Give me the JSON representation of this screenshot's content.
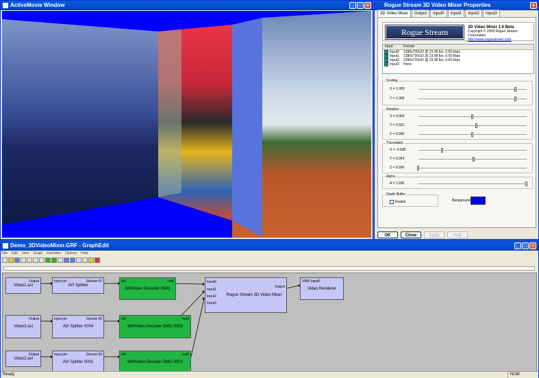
{
  "activemovie": {
    "title": "ActiveMovie Window",
    "min": "_",
    "max": "□",
    "close": "×"
  },
  "properties": {
    "title": "Rogue Stream 3D Video Mixer Properties",
    "tabs": [
      "3D Video Mixer",
      "Output",
      "Input0",
      "Input1",
      "Input2",
      "Input3"
    ],
    "banner": {
      "logo": "Rogue Stream",
      "product": "3D Video Mixer 1.0 Beta",
      "copyright": "Copyright © 2008 Rogue Stream Corporation",
      "url": "http://www.roguestream.com"
    },
    "input_list": {
      "headers": [
        "Input",
        "Format"
      ],
      "rows": [
        {
          "name": "Input0",
          "format": "1280x720x32 @ 23.98 fps, 0.00 kbps",
          "checked": true
        },
        {
          "name": "Input1",
          "format": "1280x720x32 @ 23.98 fps, 0.00 kbps",
          "checked": true
        },
        {
          "name": "Input2",
          "format": "1280x720x32 @ 23.98 fps, 0.00 kbps",
          "checked": true
        },
        {
          "name": "Input3",
          "format": "None",
          "checked": true
        }
      ]
    },
    "scaling": {
      "label": "Scaling",
      "x": "X = 1.000",
      "y": "Y = 1.000",
      "x_level": 0.9,
      "y_level": 0.9
    },
    "rotation": {
      "label": "Rotation",
      "x": "X = 0.000",
      "y": "Y = 0.591",
      "z": "Z = 0.000",
      "x_level": 0.5,
      "y_level": 0.54,
      "z_level": 0.5
    },
    "translation": {
      "label": "Translation",
      "x": "X = -0.538",
      "y": "Y = 0.043",
      "z": "Z = 0.000",
      "x_level": 0.22,
      "y_level": 0.51,
      "z_level": 0.0
    },
    "alpha": {
      "label": "Alpha",
      "a": "A = 1.000",
      "a_level": 1.0
    },
    "depth": {
      "label": "Depth Buffer",
      "enable": "Enable",
      "background": "Background",
      "bg_color": "#0000ff"
    },
    "buttons": {
      "ok": "OK",
      "close": "Close",
      "apply": "Apply",
      "help": "Help"
    }
  },
  "graphedit": {
    "title": "Demo_3DVideoMixer.GRF - GraphEdit",
    "menu": [
      "File",
      "Edit",
      "View",
      "Graph",
      "Favorites",
      "Options",
      "Help"
    ],
    "status": "Ready",
    "num": "NUM",
    "filters": {
      "video1": {
        "name": "Video1.avi",
        "out": "Output"
      },
      "video3": {
        "name": "Video3.avi",
        "out": "Output"
      },
      "video2": {
        "name": "Video2.avi",
        "out": "Output"
      },
      "split1": {
        "name": "AVI Splitter",
        "in": "input pin",
        "out": "Stream 00"
      },
      "split2": {
        "name": "AVI Splitter 0004",
        "in": "input pin",
        "out": "Stream 00"
      },
      "split3": {
        "name": "AVI Splitter 0001",
        "in": "input pin",
        "out": "Stream 00"
      },
      "dec1": {
        "name": "WMVideo Decoder DMO",
        "in": "in0",
        "out": "out0"
      },
      "dec2": {
        "name": "WMVideo Decoder DMO 0005",
        "in": "in0",
        "out": "out0"
      },
      "dec3": {
        "name": "WMVideo Decoder DMO 0002",
        "in": "in0",
        "out": "out0"
      },
      "mixer": {
        "name": "Rogue Stream 3D Video Mixer",
        "in0": "Input0",
        "in1": "Input1",
        "in2": "Input2",
        "in3": "Input3",
        "out": "Output"
      },
      "renderer": {
        "name": "Video Renderer",
        "in": "VMR Input0"
      }
    }
  },
  "colors": {
    "titlebar": "#0542c0",
    "filter_blue": "#c7c7f7",
    "filter_green": "#21b642",
    "video_bg": "#0000ff"
  }
}
